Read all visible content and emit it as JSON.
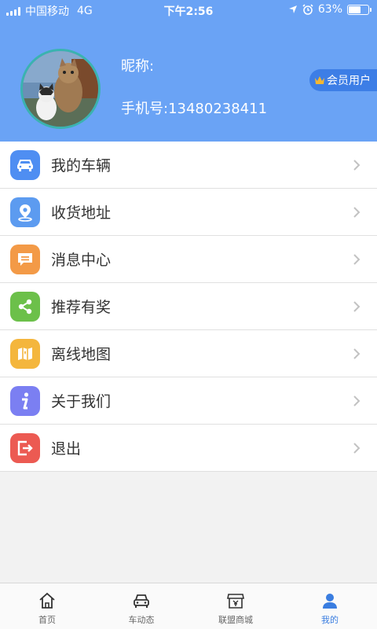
{
  "status_bar": {
    "carrier": "中国移动",
    "network": "4G",
    "time": "下午2:56",
    "battery_percent": "63%",
    "battery_level": 0.63
  },
  "profile": {
    "nickname_label": "昵称:",
    "phone_label": "手机号:13480238411",
    "vip_badge": "会员用户"
  },
  "menu": {
    "items": [
      {
        "label": "我的车辆",
        "icon": "car-icon",
        "color": "#4f8ef2"
      },
      {
        "label": "收货地址",
        "icon": "location-pin-icon",
        "color": "#5c9bf0"
      },
      {
        "label": "消息中心",
        "icon": "message-icon",
        "color": "#f39a47"
      },
      {
        "label": "推荐有奖",
        "icon": "share-icon",
        "color": "#6cc04a"
      },
      {
        "label": "离线地图",
        "icon": "map-icon",
        "color": "#f4b63d"
      },
      {
        "label": "关于我们",
        "icon": "info-icon",
        "color": "#7b7ff2"
      },
      {
        "label": "退出",
        "icon": "logout-icon",
        "color": "#ec5a52"
      }
    ]
  },
  "tabbar": {
    "tabs": [
      {
        "label": "首页",
        "icon": "home-icon"
      },
      {
        "label": "车动态",
        "icon": "car-icon"
      },
      {
        "label": "联盟商城",
        "icon": "store-icon"
      },
      {
        "label": "我的",
        "icon": "person-icon",
        "active": true
      }
    ],
    "active_color": "#3a7de0"
  }
}
